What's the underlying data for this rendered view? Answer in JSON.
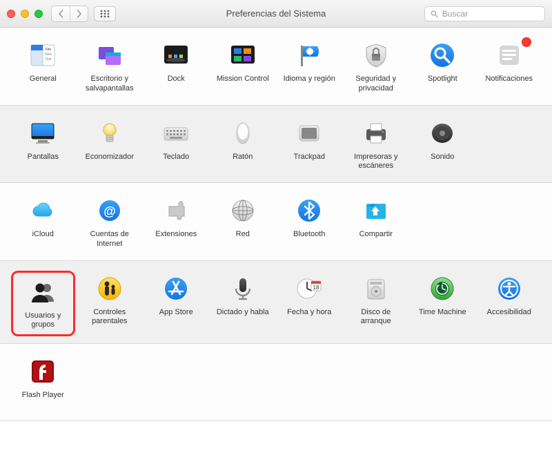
{
  "window": {
    "title": "Preferencias del Sistema",
    "search_placeholder": "Buscar"
  },
  "rows": [
    {
      "bg": "a",
      "items": [
        {
          "id": "general",
          "label": "General"
        },
        {
          "id": "desktop",
          "label": "Escritorio y salvapantallas"
        },
        {
          "id": "dock",
          "label": "Dock"
        },
        {
          "id": "mission",
          "label": "Mission Control"
        },
        {
          "id": "language",
          "label": "Idioma y región"
        },
        {
          "id": "security",
          "label": "Seguridad y privacidad"
        },
        {
          "id": "spotlight",
          "label": "Spotlight"
        },
        {
          "id": "notifications",
          "label": "Notificaciones",
          "badge": true
        }
      ]
    },
    {
      "bg": "b",
      "items": [
        {
          "id": "displays",
          "label": "Pantallas"
        },
        {
          "id": "energy",
          "label": "Economizador"
        },
        {
          "id": "keyboard",
          "label": "Teclado"
        },
        {
          "id": "mouse",
          "label": "Ratón"
        },
        {
          "id": "trackpad",
          "label": "Trackpad"
        },
        {
          "id": "printers",
          "label": "Impresoras y escáneres"
        },
        {
          "id": "sound",
          "label": "Sonido"
        }
      ]
    },
    {
      "bg": "a",
      "items": [
        {
          "id": "icloud",
          "label": "iCloud"
        },
        {
          "id": "internet",
          "label": "Cuentas de Internet"
        },
        {
          "id": "extensions",
          "label": "Extensiones"
        },
        {
          "id": "network",
          "label": "Red"
        },
        {
          "id": "bluetooth",
          "label": "Bluetooth"
        },
        {
          "id": "sharing",
          "label": "Compartir"
        }
      ]
    },
    {
      "bg": "b",
      "items": [
        {
          "id": "users",
          "label": "Usuarios y grupos",
          "highlight": true
        },
        {
          "id": "parental",
          "label": "Controles parentales"
        },
        {
          "id": "appstore",
          "label": "App Store"
        },
        {
          "id": "dictation",
          "label": "Dictado y habla"
        },
        {
          "id": "datetime",
          "label": "Fecha y hora"
        },
        {
          "id": "startup",
          "label": "Disco de arranque"
        },
        {
          "id": "timemachine",
          "label": "Time Machine"
        },
        {
          "id": "accessibility",
          "label": "Accesibilidad"
        }
      ]
    },
    {
      "bg": "a",
      "items": [
        {
          "id": "flash",
          "label": "Flash Player"
        }
      ]
    }
  ]
}
